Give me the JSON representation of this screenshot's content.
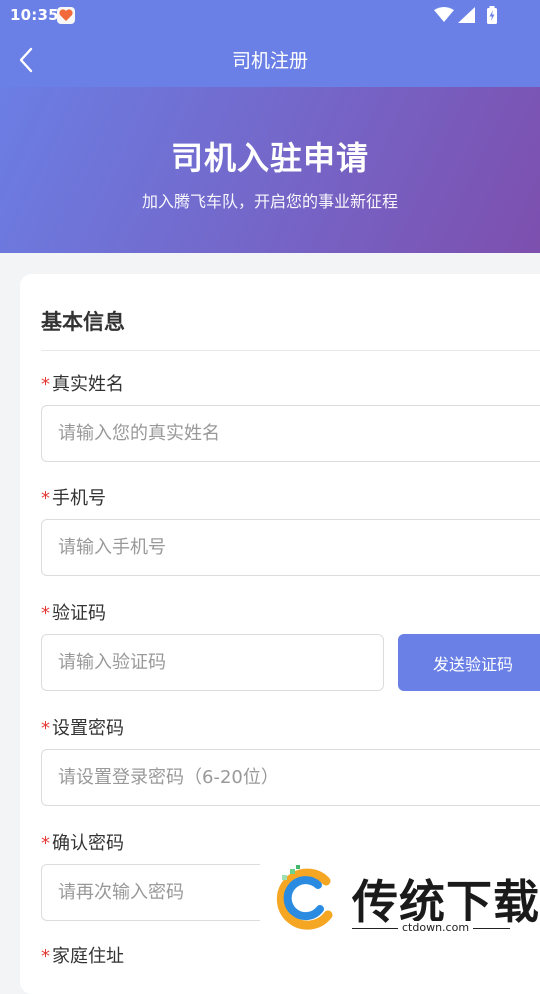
{
  "status_bar": {
    "time": "10:35",
    "icons": [
      "notification-app-icon",
      "wifi-icon",
      "signal-icon",
      "battery-icon"
    ]
  },
  "nav": {
    "title": "司机注册",
    "back_icon": "chevron-left-icon"
  },
  "hero": {
    "title": "司机入驻申请",
    "subtitle": "加入腾飞车队，开启您的事业新征程"
  },
  "form": {
    "section_title": "基本信息",
    "required_mark": "*",
    "fields": {
      "name": {
        "label": "真实姓名",
        "placeholder": "请输入您的真实姓名"
      },
      "phone": {
        "label": "手机号",
        "placeholder": "请输入手机号"
      },
      "code": {
        "label": "验证码",
        "placeholder": "请输入验证码",
        "button": "发送验证码"
      },
      "password": {
        "label": "设置密码",
        "placeholder": "请设置登录密码（6-20位）"
      },
      "confirm": {
        "label": "确认密码",
        "placeholder": "请再次输入密码"
      },
      "address": {
        "label": "家庭住址"
      }
    }
  },
  "watermark": {
    "text": "传统下载",
    "url": "ctdown.com"
  },
  "colors": {
    "accent": "#6a80e6",
    "hero_gradient_start": "#6b7ee4",
    "hero_gradient_end": "#7d4fae",
    "required": "#e53935"
  }
}
